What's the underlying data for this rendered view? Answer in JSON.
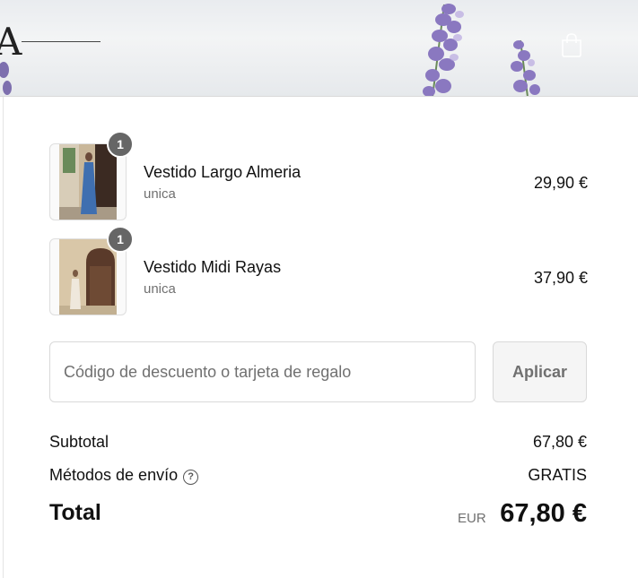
{
  "header": {
    "logo_fragment": "A",
    "cart_icon": "shopping-bag-icon"
  },
  "items": [
    {
      "quantity": "1",
      "name": "Vestido Largo Almeria",
      "variant": "unica",
      "price": "29,90 €"
    },
    {
      "quantity": "1",
      "name": "Vestido Midi Rayas",
      "variant": "unica",
      "price": "37,90 €"
    }
  ],
  "discount": {
    "placeholder": "Código de descuento o tarjeta de regalo",
    "apply_label": "Aplicar"
  },
  "summary": {
    "subtotal_label": "Subtotal",
    "subtotal_value": "67,80 €",
    "shipping_label": "Métodos de envío",
    "shipping_help_icon": "question-circle-icon",
    "shipping_value": "GRATIS",
    "total_label": "Total",
    "total_currency": "EUR",
    "total_value": "67,80 €"
  },
  "colors": {
    "badge": "#666666",
    "muted_text": "#707070",
    "border": "#d9d9d9"
  }
}
